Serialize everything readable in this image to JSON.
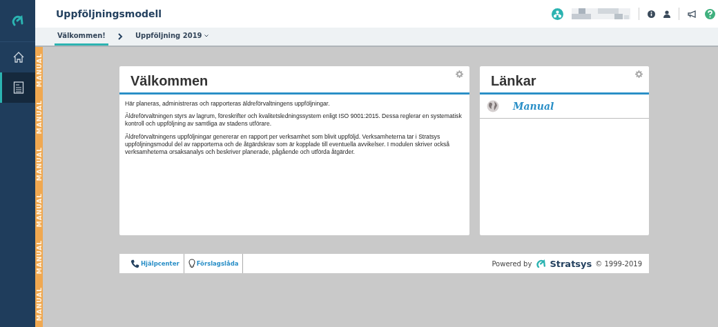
{
  "header": {
    "title": "Uppföljningsmodell"
  },
  "breadcrumbs": [
    {
      "label": "Välkommen!",
      "selected": true
    },
    {
      "label": "Uppföljning 2019",
      "selected": false
    }
  ],
  "sidebar": {
    "items": [
      {
        "kind": "home",
        "selected": false
      },
      {
        "kind": "report",
        "selected": true
      }
    ]
  },
  "environment_strip": {
    "labels": [
      "MANUAL",
      "MANUAL",
      "MANUAL",
      "MANUAL",
      "MANUAL",
      "MANUAL"
    ]
  },
  "welcome_card": {
    "title": "Välkommen",
    "paragraphs": [
      "Här planeras, administreras och rapporteras äldreförvaltningens uppföljningar.",
      "Äldreförvaltningen styrs av lagrum, föreskrifter och kvalitetsledningssystem enligt ISO 9001:2015. Dessa reglerar en systematisk kontroll och uppföljning av samtliga av stadens utförare.",
      "Äldreförvaltningens uppföljningar genererar en rapport per verksamhet som blivit uppföljd. Verksamheterna tar i Stratsys uppföljningsmodul del av rapporterna och de åtgärdskrav som är kopplade till eventuella avvikelser. I modulen skriver också verksamheterna orsaksanalys och beskriver planerade, pågående och utförda åtgärder."
    ]
  },
  "links_card": {
    "title": "Länkar",
    "links": [
      "Manual"
    ]
  },
  "footer": {
    "links": [
      {
        "kind": "phone",
        "label": "Hjälpcenter"
      },
      {
        "kind": "bulb",
        "label": "Förslagslåda"
      }
    ],
    "powered_by": "Powered by",
    "brand": "Stratsys",
    "copyright": "© 1999-2019"
  }
}
